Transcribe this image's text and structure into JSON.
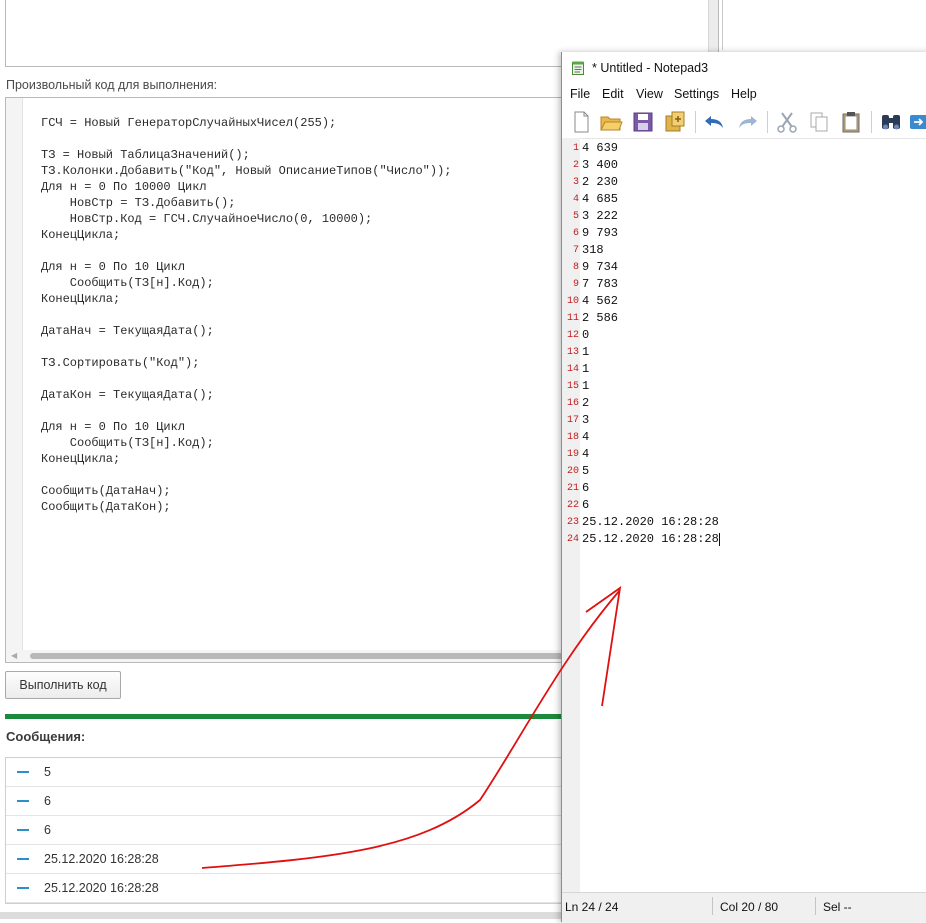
{
  "console": {
    "code_label": "Произвольный код для выполнения:",
    "code_lines": [
      "ГСЧ = Новый ГенераторСлучайныхЧисел(255);",
      "",
      "ТЗ = Новый ТаблицаЗначений();",
      "ТЗ.Колонки.Добавить(\"Код\", Новый ОписаниеТипов(\"Число\"));",
      "Для н = 0 По 10000 Цикл",
      "    НовСтр = ТЗ.Добавить();",
      "    НовСтр.Код = ГСЧ.СлучайноеЧисло(0, 10000);",
      "КонецЦикла;",
      "",
      "Для н = 0 По 10 Цикл",
      "    Сообщить(ТЗ[н].Код);",
      "КонецЦикла;",
      "",
      "ДатаНач = ТекущаяДата();",
      "",
      "ТЗ.Сортировать(\"Код\");",
      "",
      "ДатаКон = ТекущаяДата();",
      "",
      "Для н = 0 По 10 Цикл",
      "    Сообщить(ТЗ[н].Код);",
      "КонецЦикла;",
      "",
      "Сообщить(ДатаНач);",
      "Сообщить(ДатаКон);"
    ],
    "run_button": "Выполнить код",
    "messages_title": "Сообщения:",
    "messages": [
      "5",
      "6",
      "6",
      "25.12.2020 16:28:28",
      "25.12.2020 16:28:28"
    ]
  },
  "notepad": {
    "title": "* Untitled - Notepad3",
    "menu": [
      "File",
      "Edit",
      "View",
      "Settings",
      "Help"
    ],
    "toolbar_icons": [
      "new-file-icon",
      "open-folder-icon",
      "save-icon",
      "save-as-icon",
      "undo-icon",
      "redo-icon",
      "cut-icon",
      "copy-icon",
      "paste-icon",
      "find-icon",
      "replace-icon"
    ],
    "lines": [
      {
        "n": "1",
        "text": "4 639"
      },
      {
        "n": "2",
        "text": "3 400"
      },
      {
        "n": "3",
        "text": "2 230"
      },
      {
        "n": "4",
        "text": "4 685"
      },
      {
        "n": "5",
        "text": "3 222"
      },
      {
        "n": "6",
        "text": "9 793"
      },
      {
        "n": "7",
        "text": "318"
      },
      {
        "n": "8",
        "text": "9 734"
      },
      {
        "n": "9",
        "text": "7 783"
      },
      {
        "n": "10",
        "text": "4 562"
      },
      {
        "n": "11",
        "text": "2 586"
      },
      {
        "n": "12",
        "text": "0"
      },
      {
        "n": "13",
        "text": "1"
      },
      {
        "n": "14",
        "text": "1"
      },
      {
        "n": "15",
        "text": "1"
      },
      {
        "n": "16",
        "text": "2"
      },
      {
        "n": "17",
        "text": "3"
      },
      {
        "n": "18",
        "text": "4"
      },
      {
        "n": "19",
        "text": "4"
      },
      {
        "n": "20",
        "text": "5"
      },
      {
        "n": "21",
        "text": "6"
      },
      {
        "n": "22",
        "text": "6"
      },
      {
        "n": "23",
        "text": "25.12.2020 16:28:28"
      },
      {
        "n": "24",
        "text": "25.12.2020 16:28:28"
      }
    ],
    "status": {
      "ln": "Ln  24 / 24",
      "col": "Col  20 / 80",
      "sel": "Sel  --"
    }
  },
  "colors": {
    "accent_green": "#1a8a3d",
    "message_dash": "#2e8ec9",
    "annotation": "#e01010",
    "line_numbers": "#c02020"
  }
}
